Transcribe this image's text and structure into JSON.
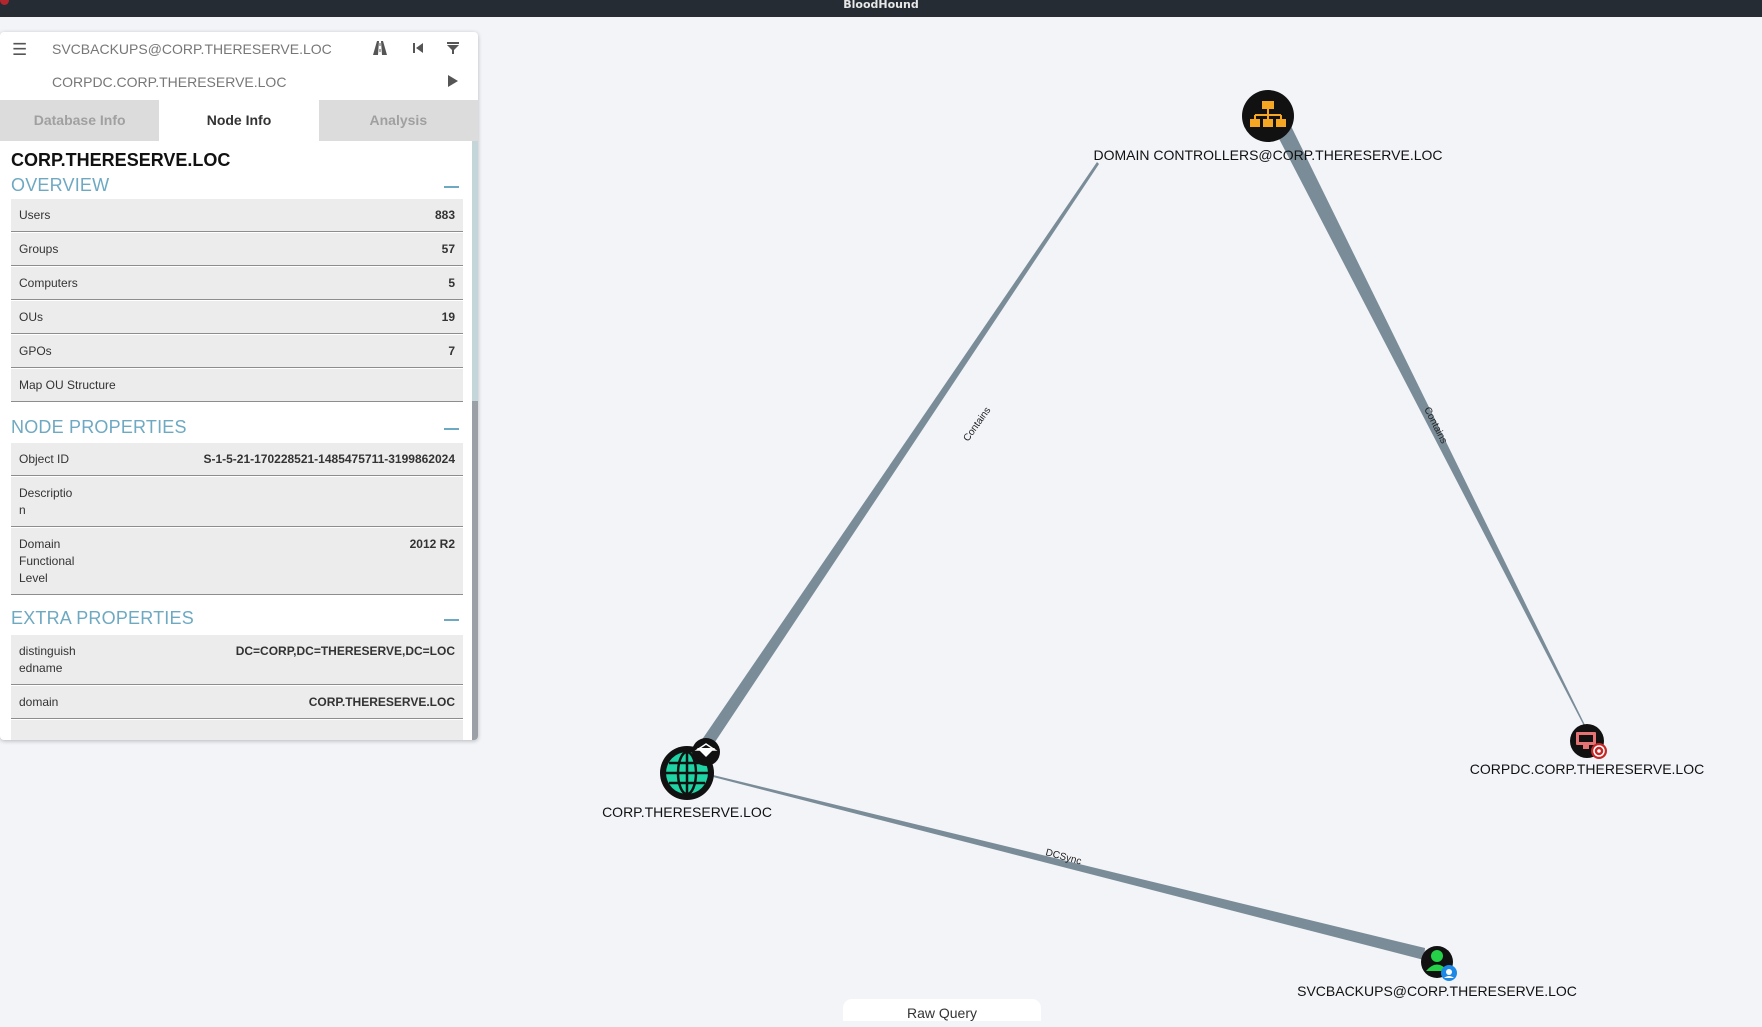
{
  "window": {
    "title": "BloodHound"
  },
  "search": {
    "start_node": "SVCBACKUPS@CORP.THERESERVE.LOC",
    "target_node": "CORPDC.CORP.THERESERVE.LOC",
    "icons": [
      "menu-icon",
      "pathfinding-icon",
      "back-icon",
      "filter-icon",
      "play-icon"
    ]
  },
  "tabs": [
    "Database Info",
    "Node Info",
    "Analysis"
  ],
  "active_tab": "Node Info",
  "node": {
    "name": "CORP.THERESERVE.LOC",
    "overview": {
      "heading": "OVERVIEW",
      "rows": [
        {
          "label": "Users",
          "value": "883"
        },
        {
          "label": "Groups",
          "value": "57"
        },
        {
          "label": "Computers",
          "value": "5"
        },
        {
          "label": "OUs",
          "value": "19"
        },
        {
          "label": "GPOs",
          "value": "7"
        },
        {
          "label": "Map OU Structure",
          "value": ""
        }
      ]
    },
    "node_properties": {
      "heading": "NODE PROPERTIES",
      "rows": [
        {
          "label": "Object ID",
          "value": "S-1-5-21-170228521-1485475711-3199862024"
        },
        {
          "label": "Descriptio n",
          "value": ""
        },
        {
          "label": "Domain Functional Level",
          "value": "2012 R2"
        }
      ]
    },
    "extra_properties": {
      "heading": "EXTRA PROPERTIES",
      "rows": [
        {
          "label": "distinguish edname",
          "value": "DC=CORP,DC=THERESERVE,DC=LOC"
        },
        {
          "label": "domain",
          "value": "CORP.THERESERVE.LOC"
        }
      ]
    }
  },
  "graph": {
    "nodes": [
      {
        "id": "dc_group",
        "label": "DOMAIN CONTROLLERS@CORP.THERESERVE.LOC",
        "type": "ou",
        "icon": "org-chart-icon",
        "color": "#f5a623"
      },
      {
        "id": "domain",
        "label": "CORP.THERESERVE.LOC",
        "type": "domain",
        "icon": "globe-icon",
        "color": "#1fd4a4"
      },
      {
        "id": "corpdc",
        "label": "CORPDC.CORP.THERESERVE.LOC",
        "type": "computer",
        "icon": "computer-icon",
        "color": "#e57373"
      },
      {
        "id": "svc",
        "label": "SVCBACKUPS@CORP.THERESERVE.LOC",
        "type": "user",
        "icon": "user-icon",
        "color": "#24d148"
      }
    ],
    "edges": [
      {
        "from": "domain",
        "to": "dc_group",
        "label": "Contains"
      },
      {
        "from": "dc_group",
        "to": "corpdc",
        "label": "Contains"
      },
      {
        "from": "svc",
        "to": "domain",
        "label": "DCSync"
      }
    ]
  },
  "footer": {
    "raw_query_label": "Raw Query"
  },
  "colors": {
    "edge": "#7a8c98",
    "section_heading": "#6ea9c2",
    "titlebar": "#262c33"
  }
}
